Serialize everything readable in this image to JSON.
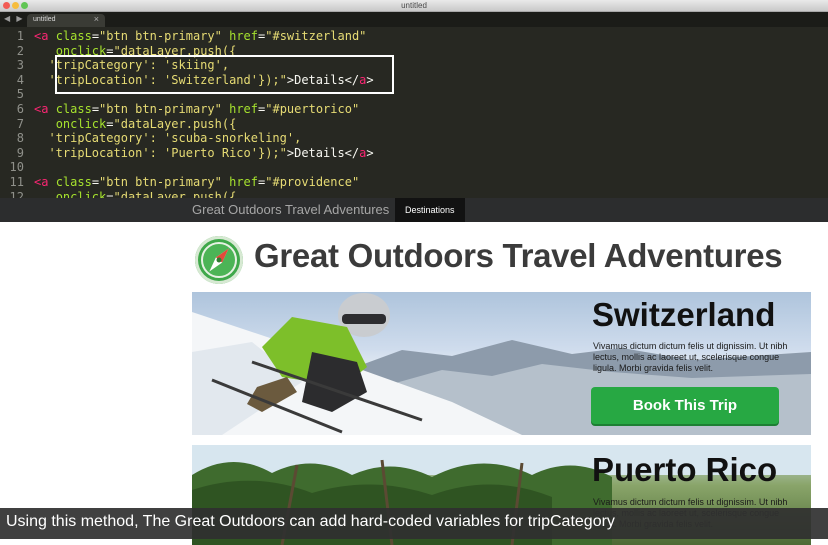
{
  "window": {
    "title": "untitled"
  },
  "tab": {
    "label": "untitled",
    "close_glyph": "×"
  },
  "nav_arrows": "◀ ▶",
  "code_lines": [
    {
      "n": "1",
      "tokens": [
        [
          "tag",
          "<a"
        ],
        [
          "op",
          " "
        ],
        [
          "attr",
          "class"
        ],
        [
          "op",
          "="
        ],
        [
          "str",
          "\"btn btn-primary\""
        ],
        [
          "op",
          " "
        ],
        [
          "attr",
          "href"
        ],
        [
          "op",
          "="
        ],
        [
          "str",
          "\"#switzerland\""
        ]
      ]
    },
    {
      "n": "2",
      "tokens": [
        [
          "op",
          "   "
        ],
        [
          "attr",
          "onclick"
        ],
        [
          "op",
          "="
        ],
        [
          "str",
          "\"dataLayer.push({"
        ]
      ]
    },
    {
      "n": "3",
      "tokens": [
        [
          "op",
          "  "
        ],
        [
          "str",
          "'tripCategory': 'skiing',"
        ]
      ]
    },
    {
      "n": "4",
      "tokens": [
        [
          "op",
          "  "
        ],
        [
          "str",
          "'tripLocation': 'Switzerland'});\""
        ],
        [
          "op",
          ">Details</"
        ],
        [
          "tag",
          "a"
        ],
        [
          "op",
          ">"
        ]
      ]
    },
    {
      "n": "5",
      "tokens": []
    },
    {
      "n": "6",
      "tokens": [
        [
          "tag",
          "<a"
        ],
        [
          "op",
          " "
        ],
        [
          "attr",
          "class"
        ],
        [
          "op",
          "="
        ],
        [
          "str",
          "\"btn btn-primary\""
        ],
        [
          "op",
          " "
        ],
        [
          "attr",
          "href"
        ],
        [
          "op",
          "="
        ],
        [
          "str",
          "\"#puertorico\""
        ]
      ]
    },
    {
      "n": "7",
      "tokens": [
        [
          "op",
          "   "
        ],
        [
          "attr",
          "onclick"
        ],
        [
          "op",
          "="
        ],
        [
          "str",
          "\"dataLayer.push({"
        ]
      ]
    },
    {
      "n": "8",
      "tokens": [
        [
          "op",
          "  "
        ],
        [
          "str",
          "'tripCategory': 'scuba-snorkeling',"
        ]
      ]
    },
    {
      "n": "9",
      "tokens": [
        [
          "op",
          "  "
        ],
        [
          "str",
          "'tripLocation': 'Puerto Rico'});\""
        ],
        [
          "op",
          ">Details</"
        ],
        [
          "tag",
          "a"
        ],
        [
          "op",
          ">"
        ]
      ]
    },
    {
      "n": "10",
      "tokens": []
    },
    {
      "n": "11",
      "tokens": [
        [
          "tag",
          "<a"
        ],
        [
          "op",
          " "
        ],
        [
          "attr",
          "class"
        ],
        [
          "op",
          "="
        ],
        [
          "str",
          "\"btn btn-primary\""
        ],
        [
          "op",
          " "
        ],
        [
          "attr",
          "href"
        ],
        [
          "op",
          "="
        ],
        [
          "str",
          "\"#providence\""
        ]
      ]
    },
    {
      "n": "12",
      "tokens": [
        [
          "op",
          "   "
        ],
        [
          "attr",
          "onclick"
        ],
        [
          "op",
          "="
        ],
        [
          "str",
          "\"dataLayer.push({"
        ]
      ]
    }
  ],
  "site": {
    "nav_brand": "Great Outdoors Travel Adventures",
    "nav_destinations": "Destinations",
    "headline": "Great Outdoors Travel Adventures",
    "cards": {
      "switzerland": {
        "title": "Switzerland",
        "text": "Vivamus dictum dictum felis ut dignissim. Ut nibh lectus, mollis ac laoreet ut, scelerisque congue ligula. Morbi gravida felis velit.",
        "button": "Book This Trip"
      },
      "puerto_rico": {
        "title": "Puerto Rico",
        "text": "Vivamus dictum dictum felis ut dignissim. Ut nibh lectus, mollis ac laoreet ut, scelerisque congue ligula. Morbi gravida felis velit."
      }
    }
  },
  "caption": "Using this method, The Great Outdoors can add hard-coded variables for tripCategory",
  "colors": {
    "editor_bg": "#272822",
    "tag": "#f92672",
    "attribute": "#a6e22e",
    "string": "#e6db74",
    "button_green": "#27a843",
    "logo_green": "#3fa84a"
  },
  "icons": {
    "logo": "compass-logo-icon",
    "close": "close-icon",
    "nav": "back-forward-arrows-icon"
  }
}
